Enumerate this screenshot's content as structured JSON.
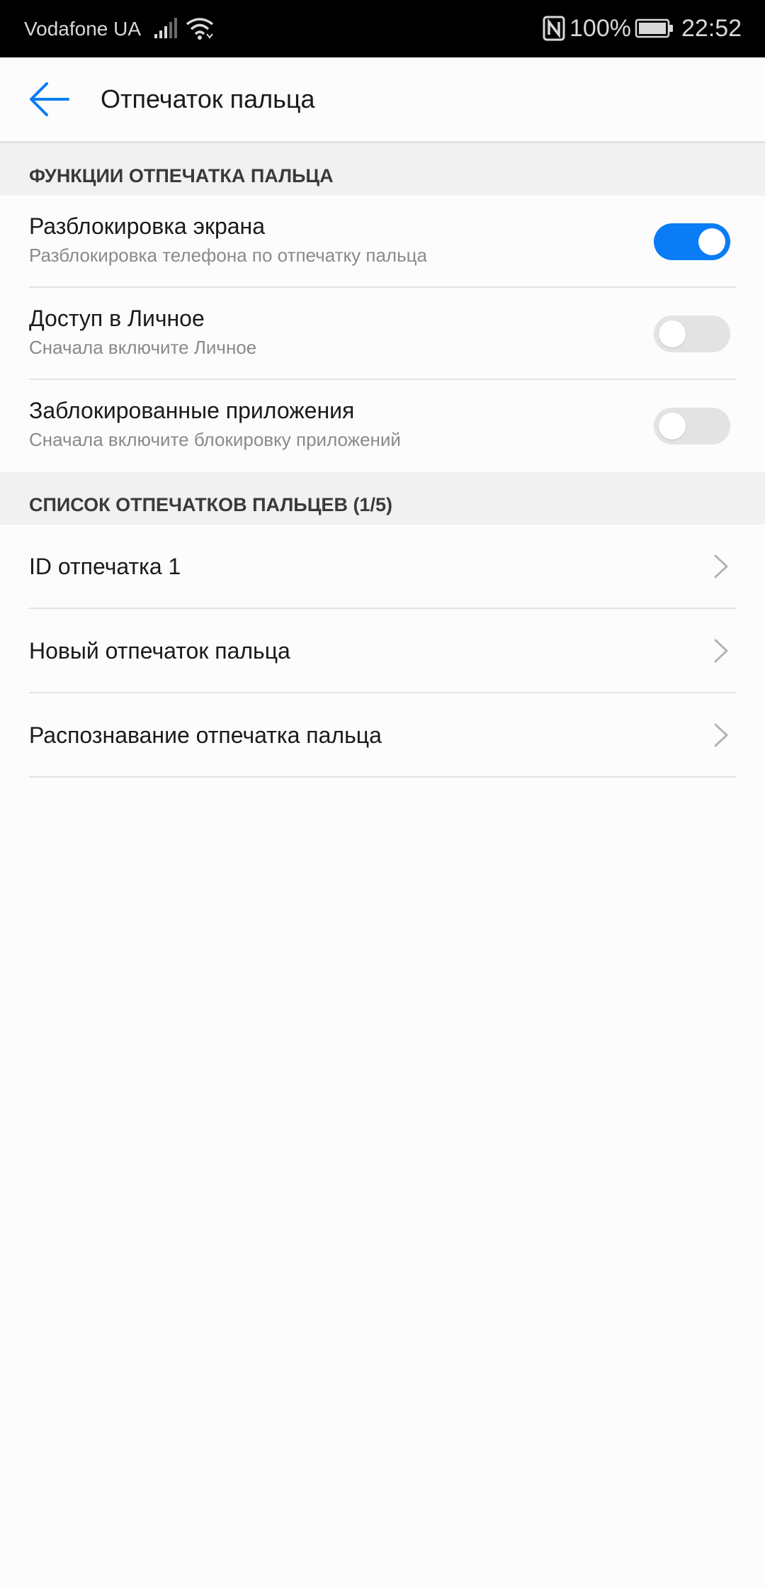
{
  "status_bar": {
    "carrier": "Vodafone UA",
    "battery_percent": "100%",
    "time": "22:52",
    "icons": [
      "signal-icon",
      "wifi-icon",
      "nfc-icon",
      "battery-icon"
    ]
  },
  "header": {
    "back_icon": "arrow-left-icon",
    "title": "Отпечаток пальца"
  },
  "sections": {
    "functions_header": "ФУНКЦИИ ОТПЕЧАТКА ПАЛЬЦА",
    "list_header": "СПИСОК ОТПЕЧАТКОВ ПАЛЬЦЕВ (1/5)"
  },
  "settings": [
    {
      "title": "Разблокировка экрана",
      "subtitle": "Разблокировка телефона по отпечатку пальца",
      "enabled": true
    },
    {
      "title": "Доступ в Личное",
      "subtitle": "Сначала включите Личное",
      "enabled": false
    },
    {
      "title": "Заблокированные приложения",
      "subtitle": "Сначала включите блокировку приложений",
      "enabled": false
    }
  ],
  "fingerprints": [
    {
      "label": "ID отпечатка 1"
    },
    {
      "label": "Новый отпечаток пальца"
    },
    {
      "label": "Распознавание отпечатка пальца"
    }
  ],
  "colors": {
    "accent": "#0a7cf5",
    "toggle_off": "#e3e3e3",
    "section_bg": "#f1f1f1",
    "page_bg": "#fcfcfc"
  }
}
